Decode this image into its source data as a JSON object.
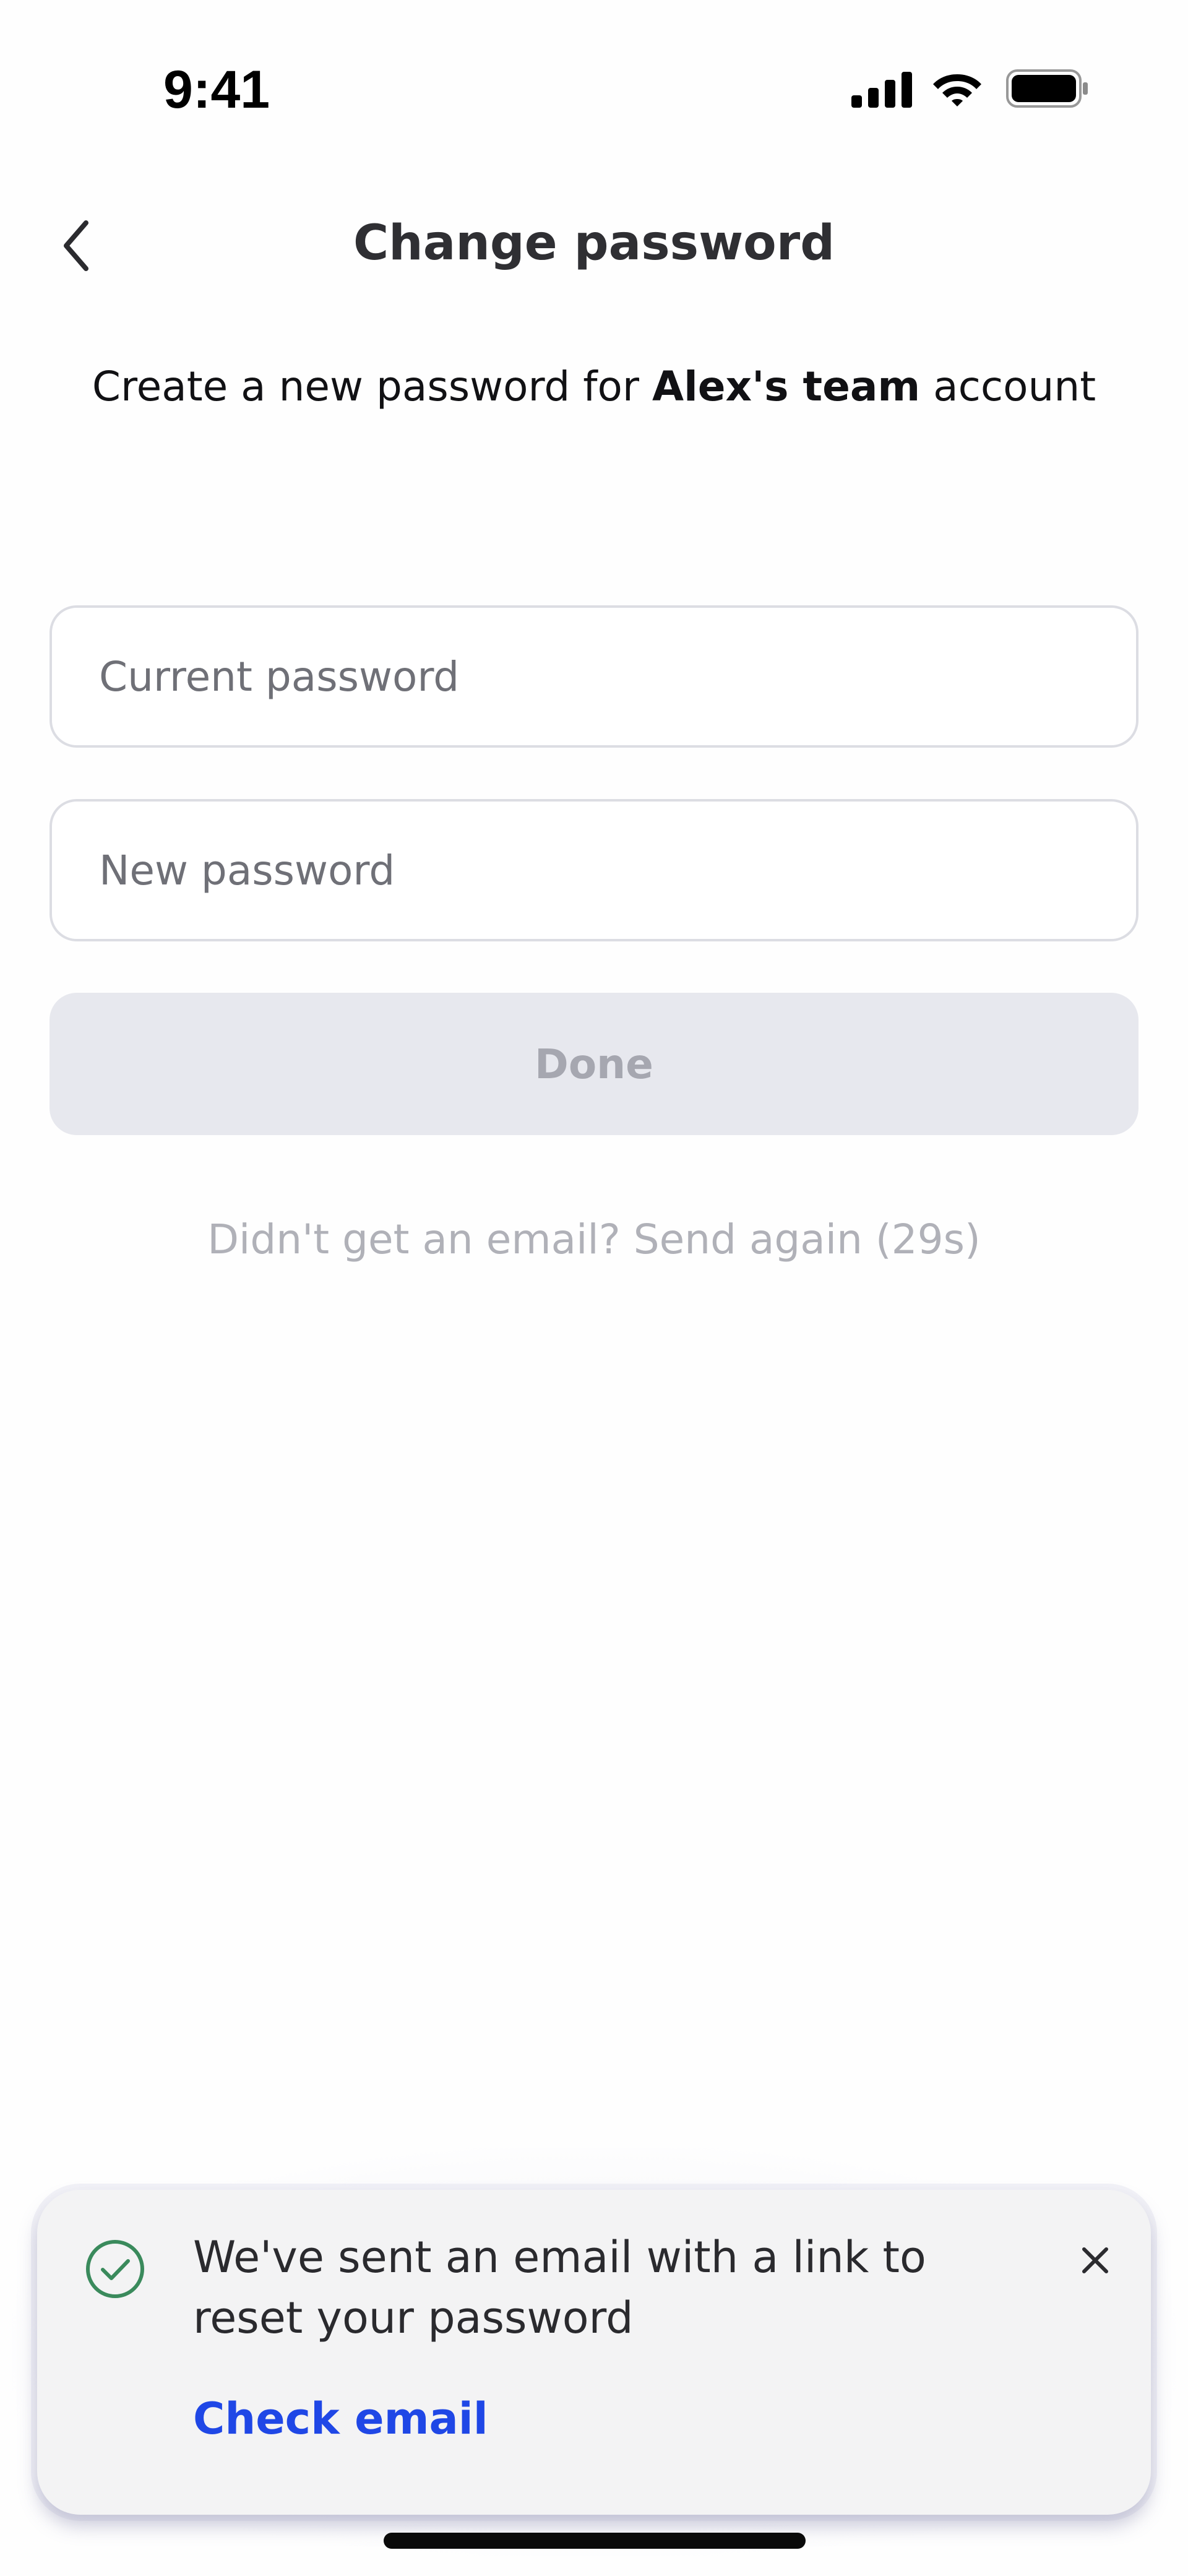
{
  "status_bar": {
    "time": "9:41",
    "icons": [
      "cellular-signal-icon",
      "wifi-icon",
      "battery-icon"
    ]
  },
  "header": {
    "back_icon": "chevron-left-icon",
    "title": "Change password"
  },
  "subtitle": {
    "prefix": "Create a new password for ",
    "team": "Alex's team",
    "suffix": " account"
  },
  "form": {
    "current_password": {
      "value": "",
      "placeholder": "Current password"
    },
    "new_password": {
      "value": "",
      "placeholder": "New password"
    },
    "done_label": "Done",
    "done_enabled": false,
    "resend_text": "Didn't get an email? Send again (29s)"
  },
  "toast": {
    "icon": "check-circle-icon",
    "message": "We've sent an email with a link to reset your password",
    "link_label": "Check email",
    "close_icon": "close-icon"
  },
  "colors": {
    "accent_link": "#1f47e6",
    "success": "#3a8a5c",
    "disabled_button_bg": "#e7e8ee",
    "disabled_button_text": "#a6a7b0"
  }
}
